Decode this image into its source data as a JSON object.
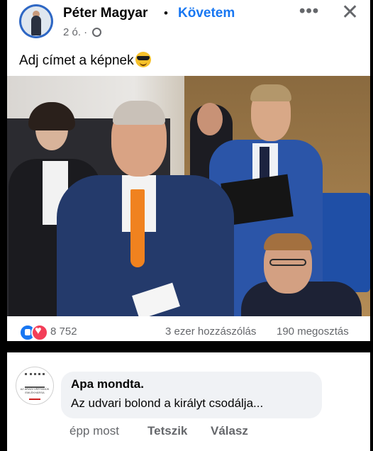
{
  "post": {
    "author": "Péter Magyar",
    "separator": "•",
    "follow_label": "Követem",
    "time": "2 ó. ·",
    "more_label": "•••",
    "close_label": "✕",
    "caption": "Adj címet a képnek",
    "caption_emoji": "smiling-face-with-sunglasses"
  },
  "stats": {
    "reactions": "8 752",
    "comments": "3 ezer hozzászólás",
    "shares": "190 megosztás",
    "reaction_icons": [
      "like-icon",
      "love-icon"
    ]
  },
  "comment": {
    "avatar_text": "AZ ARADI VÉRTANÚK EMLÉKHÁRSA",
    "author": "Apa mondta.",
    "text": "Az udvari bolond a királyt csodálja...",
    "time": "épp most",
    "like_label": "Tetszik",
    "reply_label": "Válasz"
  },
  "colors": {
    "accent": "#1877f2",
    "secondary_text": "#65676b",
    "love": "#f33e58",
    "bubble": "#f0f2f5"
  }
}
